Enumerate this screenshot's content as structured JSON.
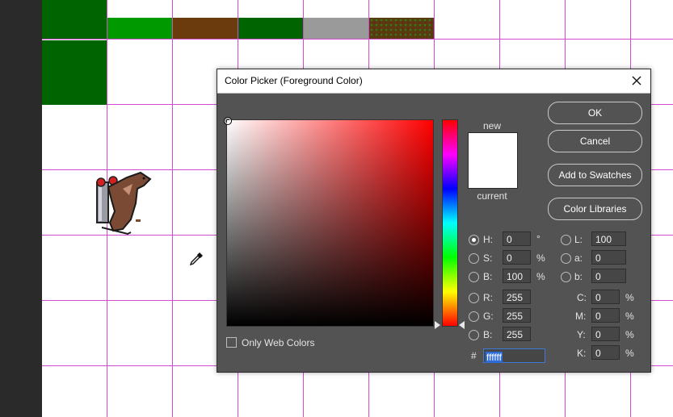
{
  "dialog": {
    "title": "Color Picker (Foreground Color)",
    "preview": {
      "new_label": "new",
      "current_label": "current",
      "new_color": "#ffffff",
      "current_color": "#ffffff"
    },
    "buttons": {
      "ok": "OK",
      "cancel": "Cancel",
      "add_to_swatches": "Add to Swatches",
      "color_libraries": "Color Libraries"
    },
    "only_web_colors": {
      "label": "Only Web Colors",
      "checked": false
    },
    "fields": {
      "H": {
        "label": "H:",
        "value": "0",
        "unit": "°",
        "selected": true
      },
      "S": {
        "label": "S:",
        "value": "0",
        "unit": "%",
        "selected": false
      },
      "B": {
        "label": "B:",
        "value": "100",
        "unit": "%",
        "selected": false
      },
      "R": {
        "label": "R:",
        "value": "255",
        "selected": false
      },
      "G": {
        "label": "G:",
        "value": "255",
        "selected": false
      },
      "Bl": {
        "label": "B:",
        "value": "255",
        "selected": false
      },
      "L": {
        "label": "L:",
        "value": "100",
        "selected": false
      },
      "a": {
        "label": "a:",
        "value": "0",
        "selected": false
      },
      "b": {
        "label": "b:",
        "value": "0",
        "selected": false
      },
      "C": {
        "label": "C:",
        "value": "0",
        "unit": "%"
      },
      "M": {
        "label": "M:",
        "value": "0",
        "unit": "%"
      },
      "Y": {
        "label": "Y:",
        "value": "0",
        "unit": "%"
      },
      "K": {
        "label": "K:",
        "value": "0",
        "unit": "%"
      }
    },
    "hex": {
      "label": "#",
      "value": "ffffff"
    }
  },
  "canvas": {
    "swatches": [
      "#009900",
      "#6b3a0d",
      "#006400",
      "#9a9a9a",
      "#5a3b10"
    ],
    "grid_color": "#d24cd2",
    "dark_green": "#006400"
  }
}
